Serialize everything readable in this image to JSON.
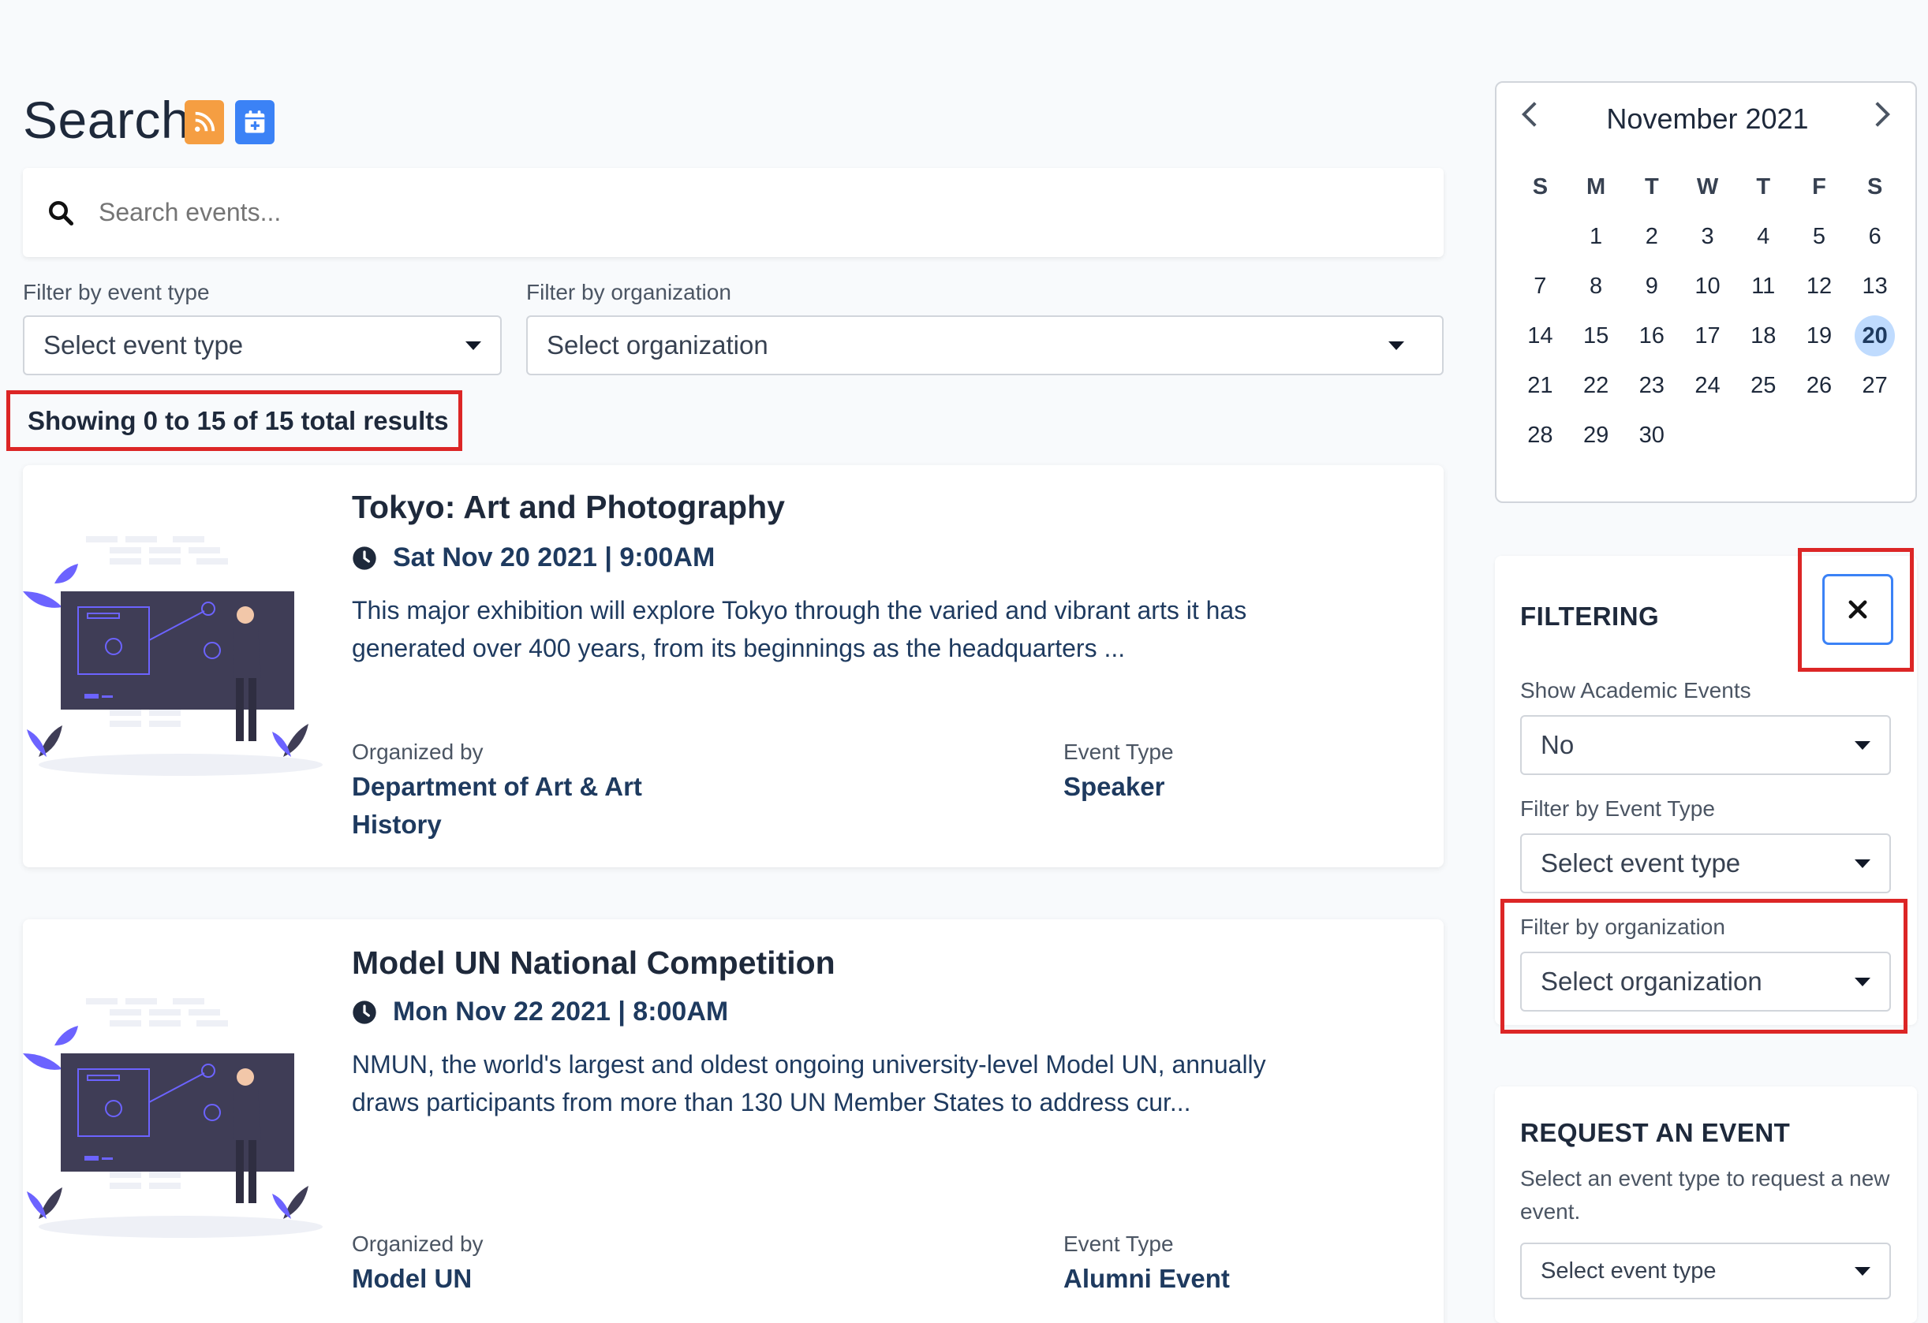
{
  "header": {
    "title": "Search",
    "rss_icon": "rss-icon",
    "calendar_add_icon": "calendar-plus-icon"
  },
  "search": {
    "placeholder": "Search events..."
  },
  "filters": {
    "event_type_label": "Filter by event type",
    "event_type_value": "Select event type",
    "organization_label": "Filter by organization",
    "organization_value": "Select organization"
  },
  "results": {
    "summary": "Showing 0 to 15 of 15 total results"
  },
  "events": [
    {
      "title": "Tokyo: Art and Photography",
      "date": "Sat Nov 20 2021 | 9:00AM",
      "description_line1": "This major exhibition will explore Tokyo through the varied and vibrant arts it has",
      "description_line2": "generated over 400 years, from its beginnings as the headquarters ...",
      "organized_by_label": "Organized by",
      "organized_by_line1": "Department of Art & Art",
      "organized_by_line2": "History",
      "event_type_label": "Event Type",
      "event_type": "Speaker"
    },
    {
      "title": "Model UN National Competition",
      "date": "Mon Nov 22 2021 | 8:00AM",
      "description_line1": "NMUN, the world's largest and oldest ongoing university-level Model UN, annually",
      "description_line2": "draws participants from more than 130 UN Member States to address cur...",
      "organized_by_label": "Organized by",
      "organized_by_line1": "Model UN",
      "organized_by_line2": "",
      "event_type_label": "Event Type",
      "event_type": "Alumni Event"
    }
  ],
  "calendar": {
    "month": "November 2021",
    "prev": "‹",
    "next": "›",
    "weekdays": [
      "S",
      "M",
      "T",
      "W",
      "T",
      "F",
      "S"
    ],
    "weeks": [
      [
        "",
        "1",
        "2",
        "3",
        "4",
        "5",
        "6"
      ],
      [
        "7",
        "8",
        "9",
        "10",
        "11",
        "12",
        "13"
      ],
      [
        "14",
        "15",
        "16",
        "17",
        "18",
        "19",
        "20"
      ],
      [
        "21",
        "22",
        "23",
        "24",
        "25",
        "26",
        "27"
      ],
      [
        "28",
        "29",
        "30",
        "",
        "",
        "",
        ""
      ]
    ],
    "today": "20"
  },
  "filtering": {
    "title": "FILTERING",
    "close_icon": "close-icon",
    "academic_label": "Show Academic Events",
    "academic_value": "No",
    "event_type_label": "Filter by Event Type",
    "event_type_value": "Select event type",
    "organization_label": "Filter by organization",
    "organization_value": "Select organization"
  },
  "request": {
    "title": "REQUEST AN EVENT",
    "description": "Select an event type to request a new event.",
    "select_value": "Select event type"
  },
  "colors": {
    "highlight": "#dc2626",
    "accent": "#3b82f6",
    "rss": "#f59e42",
    "today_bg": "#bfdbfe"
  }
}
